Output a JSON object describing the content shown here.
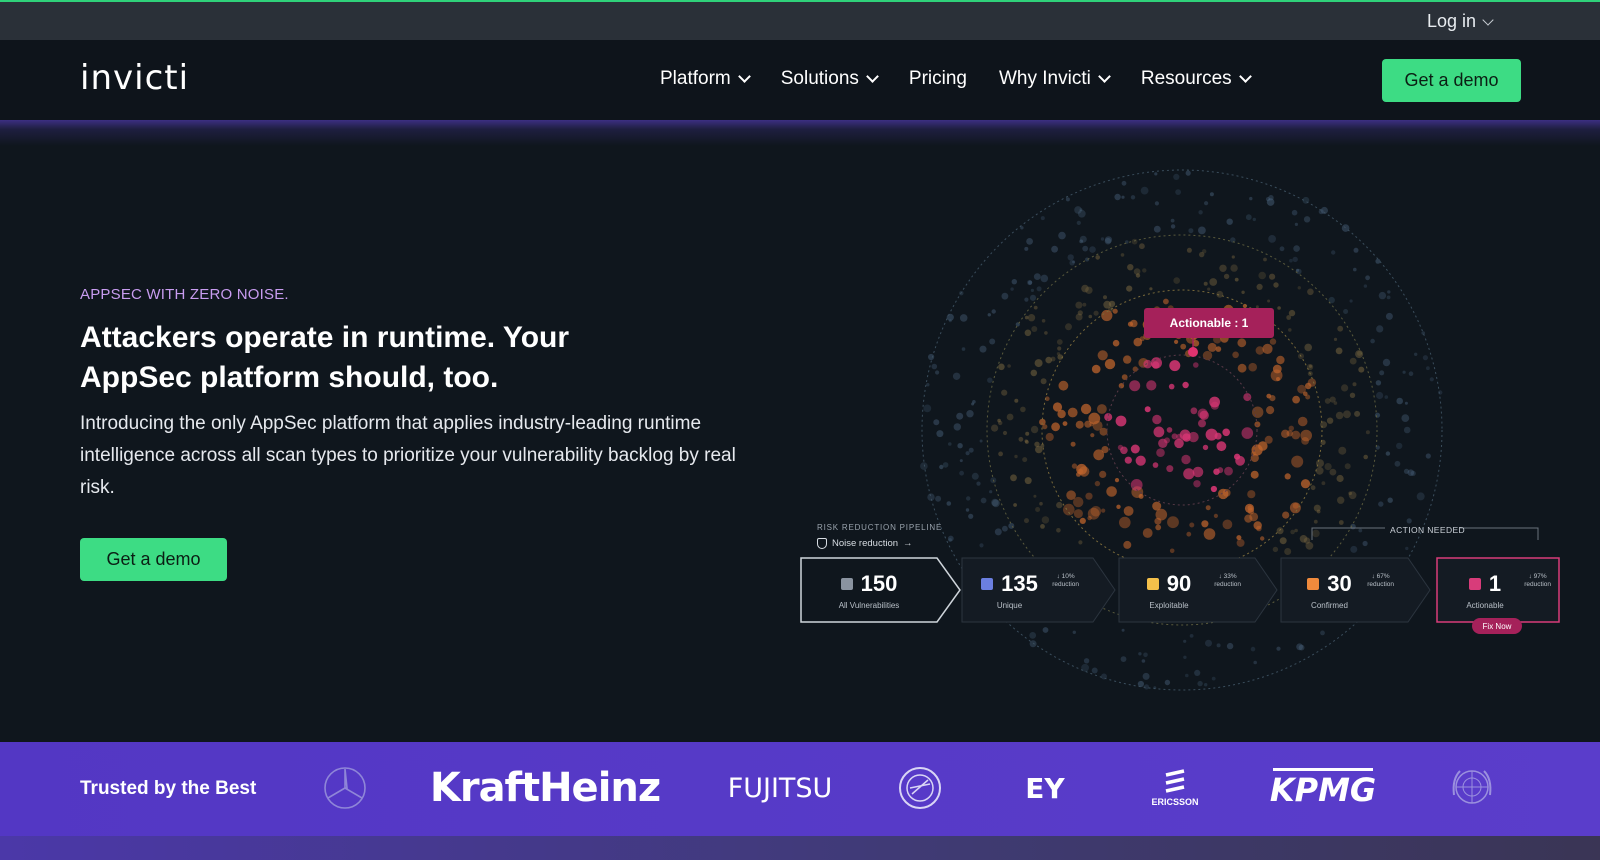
{
  "topbar": {
    "login_label": "Log in"
  },
  "nav": {
    "logo": "invicti",
    "menu": [
      {
        "label": "Platform",
        "dropdown": true
      },
      {
        "label": "Solutions",
        "dropdown": true
      },
      {
        "label": "Pricing",
        "dropdown": false
      },
      {
        "label": "Why Invicti",
        "dropdown": true
      },
      {
        "label": "Resources",
        "dropdown": true
      }
    ],
    "cta_label": "Get a demo"
  },
  "hero": {
    "eyebrow": "APPSEC WITH ZERO NOISE.",
    "headline_line1": "Attackers operate in runtime. Your",
    "headline_line2": "AppSec platform should, too.",
    "lead": "Introducing the only AppSec platform that applies industry-leading runtime intelligence across all scan types to prioritize your vulnerability backlog by real risk.",
    "cta_label": "Get a demo"
  },
  "viz": {
    "actionable_tag": "Actionable : 1",
    "pipeline_title": "RISK REDUCTION PIPELINE",
    "noise_label": "Noise reduction",
    "action_needed": "ACTION NEEDED",
    "fix_now": "Fix Now",
    "stages": [
      {
        "value": "150",
        "label": "All Vulnerabilities",
        "pct": "",
        "color": "#8a93a0"
      },
      {
        "value": "135",
        "label": "Unique",
        "pct": "↓ 10%",
        "color": "#6b7fe0"
      },
      {
        "value": "90",
        "label": "Exploitable",
        "pct": "↓ 33%",
        "color": "#f4c04a"
      },
      {
        "value": "30",
        "label": "Confirmed",
        "pct": "↓ 67%",
        "color": "#f08a3c"
      },
      {
        "value": "1",
        "label": "Actionable",
        "pct": "↓ 97%",
        "color": "#d83c7a"
      }
    ],
    "pct_suffix": "reduction"
  },
  "trusted": {
    "title": "Trusted by the Best",
    "logos": [
      "mercedes-benz-logo",
      "KraftHeinz",
      "FUJITSU",
      "seal-logo",
      "EY",
      "ERICSSON",
      "KPMG",
      "united-nations-logo"
    ]
  },
  "colors": {
    "accent_green": "#3ddc84",
    "purple_band": "#5539c6",
    "actionable_red": "#a5215a"
  }
}
